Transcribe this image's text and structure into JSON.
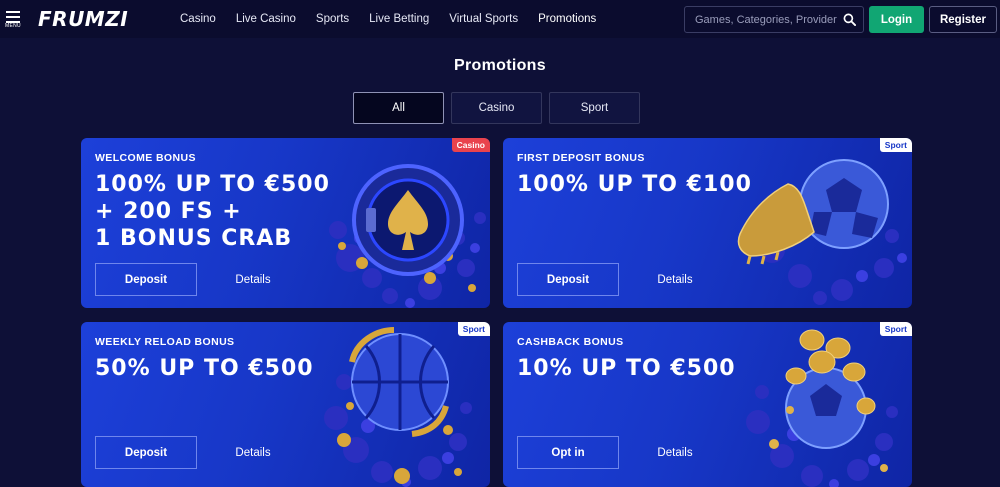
{
  "header": {
    "menu_label": "MENU",
    "logo": "FRUMZI",
    "nav": [
      {
        "label": "Casino"
      },
      {
        "label": "Live Casino"
      },
      {
        "label": "Sports"
      },
      {
        "label": "Live Betting"
      },
      {
        "label": "Virtual Sports"
      },
      {
        "label": "Promotions"
      }
    ],
    "search_placeholder": "Games, Categories, Providers",
    "login_label": "Login",
    "register_label": "Register"
  },
  "page": {
    "title": "Promotions",
    "filters": [
      {
        "label": "All",
        "active": true
      },
      {
        "label": "Casino",
        "active": false
      },
      {
        "label": "Sport",
        "active": false
      }
    ]
  },
  "promotions": [
    {
      "kicker": "WELCOME BONUS",
      "headline": "100% UP TO €500\n+ 200 FS +\n1 BONUS CRAB",
      "tag": "Casino",
      "primary_label": "Deposit",
      "details_label": "Details",
      "art": "slot-spade-icon"
    },
    {
      "kicker": "FIRST DEPOSIT BONUS",
      "headline": "100% UP TO €100",
      "tag": "Sport",
      "primary_label": "Deposit",
      "details_label": "Details",
      "art": "soccer-boot-icon"
    },
    {
      "kicker": "WEEKLY RELOAD BONUS",
      "headline": "50% UP TO €500",
      "tag": "Sport",
      "primary_label": "Deposit",
      "details_label": "Details",
      "art": "basketball-icon"
    },
    {
      "kicker": "CASHBACK BONUS",
      "headline": "10% UP TO €500",
      "tag": "Sport",
      "primary_label": "Opt in",
      "details_label": "Details",
      "art": "coins-ball-icon"
    }
  ],
  "colors": {
    "background": "#0e1037",
    "card_blue": "#1737c7",
    "login_green": "#11a673",
    "casino_tag": "#e9434d",
    "gold": "#d8a63a"
  }
}
